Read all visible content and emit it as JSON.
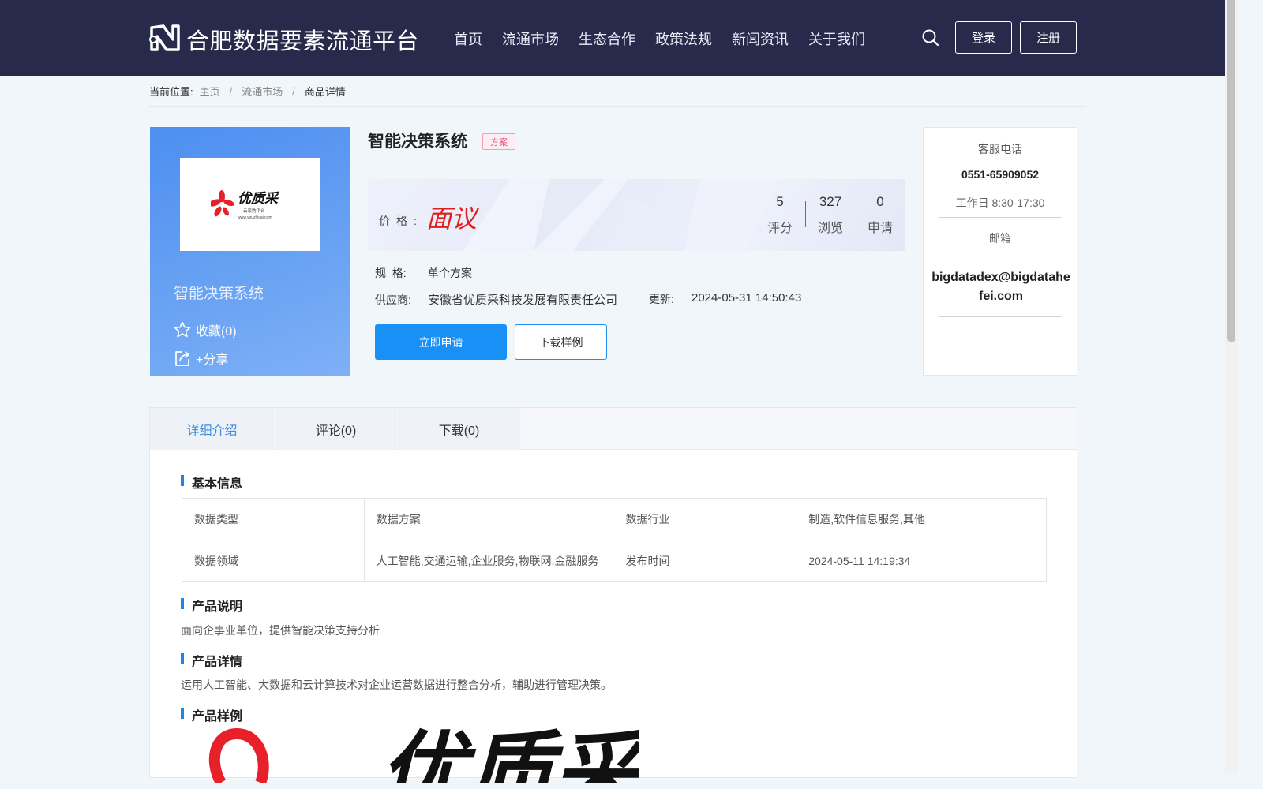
{
  "header": {
    "site_title": "合肥数据要素流通平台",
    "nav": [
      "首页",
      "流通市场",
      "生态合作",
      "政策法规",
      "新闻资讯",
      "关于我们"
    ],
    "login": "登录",
    "register": "注册"
  },
  "breadcrumb": {
    "label": "当前位置:",
    "items": [
      "主页",
      "流通市场",
      "商品详情"
    ]
  },
  "product": {
    "logo_brand": "优质采",
    "logo_sub": "— 云采购平台 —",
    "logo_url": "www.youzhicai.com",
    "name": "智能决策系统",
    "favorite": "收藏(0)",
    "share": "+分享",
    "title": "智能决策系统",
    "tag": "方案",
    "price_label": "价格:",
    "price_value": "面议",
    "stats": [
      {
        "num": "5",
        "label": "评分"
      },
      {
        "num": "327",
        "label": "浏览"
      },
      {
        "num": "0",
        "label": "申请"
      }
    ],
    "spec_label": "规  格:",
    "spec_value": "单个方案",
    "supplier_label": "供应商:",
    "supplier_value": "安徽省优质采科技发展有限责任公司",
    "update_label": "更新:",
    "update_value": "2024-05-31 14:50:43",
    "apply_button": "立即申请",
    "sample_button": "下载样例"
  },
  "contact": {
    "phone_label": "客服电话",
    "phone": "0551-65909052",
    "hours": "工作日 8:30-17:30",
    "email_label": "邮箱",
    "email": "bigdatadex@bigdatahefei.com"
  },
  "tabs": [
    "详细介绍",
    "评论(0)",
    "下载(0)"
  ],
  "basic_info": {
    "title": "基本信息",
    "rows": [
      [
        "数据类型",
        "数据方案",
        "数据行业",
        "制造,软件信息服务,其他"
      ],
      [
        "数据领域",
        "人工智能,交通运输,企业服务,物联网,金融服务",
        "发布时间",
        "2024-05-11 14:19:34"
      ]
    ]
  },
  "description": {
    "title": "产品说明",
    "text": "面向企事业单位，提供智能决策支持分析"
  },
  "details": {
    "title": "产品详情",
    "text": "运用人工智能、大数据和云计算技术对企业运营数据进行整合分析，辅助进行管理决策。"
  },
  "sample": {
    "title": "产品样例",
    "brand": "优质采"
  },
  "colors": {
    "header_bg": "#282a4b",
    "accent": "#1990f5",
    "price": "#e21d1d",
    "tag": "#e0457b"
  }
}
